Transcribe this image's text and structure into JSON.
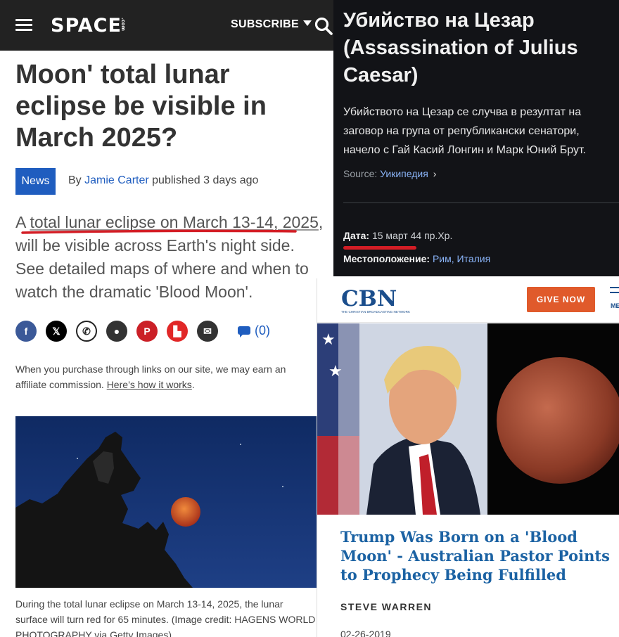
{
  "space": {
    "header": {
      "logo": "SPACE",
      "logo_suffix": ".com",
      "subscribe_label": "SUBSCRIBE"
    },
    "article": {
      "title": "Moon' total lunar eclipse be visible in March 2025?",
      "badge": "News",
      "byline_prefix": "By",
      "author": "Jamie Carter",
      "published": "published 3 days ago",
      "lede_a": "A",
      "lede_link": "total lunar eclipse on March 13-14, 2025",
      "lede_rest": ", will be visible across Earth's night side. See detailed maps of where and when to watch the dramatic 'Blood Moon'.",
      "comments_count": "(0)",
      "affiliate_text": "When you purchase through links on our site, we may earn an affiliate commission.",
      "affiliate_link": "Here’s how it works",
      "affiliate_end": ".",
      "caption": "During the total lunar eclipse on March 13-14, 2025, the lunar surface will turn red for 65 minutes. (Image credit: HAGENS WORLD PHOTOGRAPHY via Getty Images)"
    },
    "share_icons": [
      "facebook-icon",
      "x-icon",
      "whatsapp-icon",
      "reddit-icon",
      "pinterest-icon",
      "flipboard-icon",
      "email-icon"
    ]
  },
  "wiki": {
    "title": "Убийство на Цезар (Assassination of Julius Caesar)",
    "description": "Убийството на Цезар се случва в резултат на заговор на група от републикански сенатори, начело с Гай Касий Лонгин и Марк Юний Брут.",
    "source_label": "Source:",
    "source_link": "Уикипедия",
    "source_arrow": "›",
    "date_label": "Дата:",
    "date_value": "15 март 44 пр.Хр.",
    "location_label": "Местоположение:",
    "location_value": "Рим, Италия"
  },
  "cbn": {
    "logo": "CBN",
    "logo_tagline": "THE CHRISTIAN BROADCASTING NETWORK",
    "give_now": "GIVE NOW",
    "menu_label": "ME",
    "headline": "Trump Was Born on a 'Blood Moon' - Australian Pastor Points to Prophecy Being Fulfilled",
    "author": "STEVE WARREN",
    "date": "02-26-2019"
  },
  "colors": {
    "space_header": "#222222",
    "news_blue": "#1f5dbf",
    "annotation_red": "#d31d25",
    "wiki_bg": "#121317",
    "wiki_link": "#8ab4f8",
    "cbn_orange": "#e05a2b",
    "cbn_blue": "#1b62a3"
  }
}
